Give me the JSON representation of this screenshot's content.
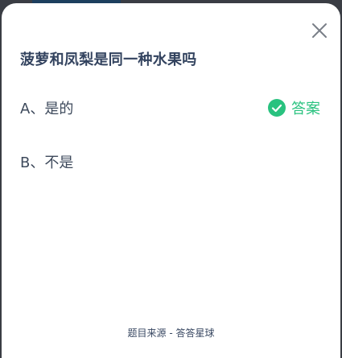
{
  "question": {
    "title": "菠萝和凤梨是同一种水果吗"
  },
  "options": [
    {
      "label": "A、是的",
      "is_answer": true
    },
    {
      "label": "B、不是",
      "is_answer": false
    }
  ],
  "answer_tag": {
    "label": "答案",
    "icon": "check-circle-icon"
  },
  "close": {
    "icon": "close-icon"
  },
  "footer": {
    "source": "题目来源 - 答答星球"
  },
  "colors": {
    "accent": "#29c27f",
    "title": "#33435f",
    "option_text": "#3e4a5c",
    "icon_gray": "#7a7f88"
  }
}
